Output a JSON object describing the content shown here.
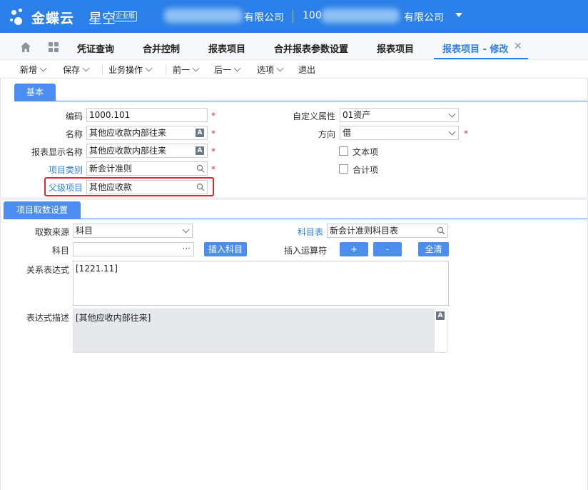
{
  "header": {
    "brand": "金蝶云",
    "brand_suffix": "星空",
    "edition": "企业版",
    "org_left": "有限公司",
    "org_right_prefix": "100",
    "org_right_suffix": "有限公司",
    "bg_color": "#2a7fe8"
  },
  "tabs": [
    {
      "label": "凭证查询"
    },
    {
      "label": "合并控制"
    },
    {
      "label": "报表项目"
    },
    {
      "label": "合并报表参数设置"
    },
    {
      "label": "报表项目"
    },
    {
      "label": "报表项目 - 修改",
      "active": true
    }
  ],
  "toolbar": {
    "new": "新增",
    "save": "保存",
    "business": "业务操作",
    "prev": "前一",
    "next": "后一",
    "options": "选项",
    "exit": "退出"
  },
  "basic": {
    "section_title": "基本",
    "code_label": "编码",
    "code_value": "1000.101",
    "name_label": "名称",
    "name_value": "其他应收款内部往来",
    "display_label": "报表显示名称",
    "display_value": "其他应收款内部往来",
    "category_label": "项目类别",
    "category_value": "新会计准则",
    "parent_label": "父级项目",
    "parent_value": "其他应收款",
    "custom_attr_label": "自定义属性",
    "custom_attr_value": "01资产",
    "direction_label": "方向",
    "direction_value": "借",
    "text_item_label": "文本项",
    "total_item_label": "合计项",
    "required_mark": "*",
    "lang_icon_text": "A"
  },
  "fetch": {
    "section_title": "项目取数设置",
    "source_label": "取数来源",
    "source_value": "科目",
    "account_table_label": "科目表",
    "account_table_value": "新会计准则科目表",
    "account_label": "科目",
    "account_value": "",
    "more_dots": "···",
    "insert_account_button": "插入科目",
    "insert_operator_label": "插入运算符",
    "plus_button": "+",
    "minus_button": "-",
    "clear_button": "全清",
    "expression_label": "关系表达式",
    "expression_value": "[1221.11]",
    "description_label": "表达式描述",
    "description_value": "[其他应收内部往来]"
  }
}
